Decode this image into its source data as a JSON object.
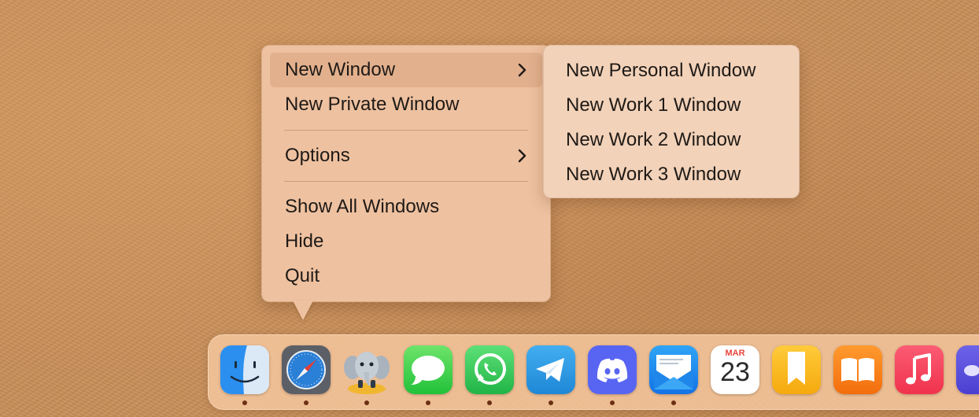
{
  "context_menu": {
    "items": [
      {
        "label": "New Window",
        "has_submenu": true,
        "highlighted": true
      },
      {
        "label": "New Private Window"
      },
      {
        "label": "Options",
        "has_submenu": true
      },
      {
        "label": "Show All Windows"
      },
      {
        "label": "Hide"
      },
      {
        "label": "Quit"
      }
    ]
  },
  "submenu": {
    "items": [
      {
        "label": "New Personal Window"
      },
      {
        "label": "New Work 1 Window"
      },
      {
        "label": "New Work 2 Window"
      },
      {
        "label": "New Work 3 Window"
      }
    ]
  },
  "dock": {
    "apps": [
      {
        "icon": "finder-icon",
        "running": true
      },
      {
        "icon": "safari-icon",
        "running": true
      },
      {
        "icon": "tableplus-elephant-icon",
        "running": true
      },
      {
        "icon": "messages-icon",
        "running": true
      },
      {
        "icon": "whatsapp-icon",
        "running": true
      },
      {
        "icon": "telegram-icon",
        "running": true
      },
      {
        "icon": "discord-icon",
        "running": true
      },
      {
        "icon": "mail-icon",
        "running": true
      },
      {
        "icon": "calendar-icon",
        "running": false,
        "month": "MAR",
        "day": "23"
      },
      {
        "icon": "bookmark-icon",
        "running": false
      },
      {
        "icon": "books-icon",
        "running": false
      },
      {
        "icon": "music-icon",
        "running": false
      },
      {
        "icon": "partial-app-icon",
        "running": false
      }
    ]
  },
  "colors": {
    "menu_bg": "#eec1a0",
    "menu_highlight": "#e2b08d",
    "submenu_bg": "#f2d2b9",
    "desktop": "#c9905a",
    "running_dot": "#6b2f14"
  }
}
